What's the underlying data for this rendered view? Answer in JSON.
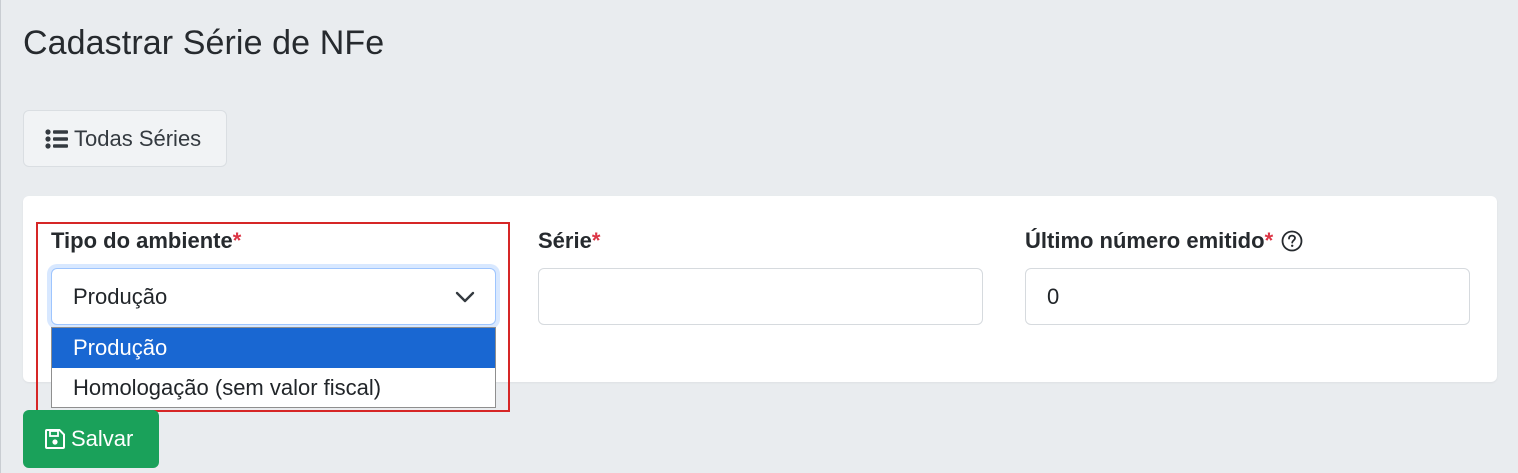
{
  "page": {
    "title": "Cadastrar Série de NFe"
  },
  "toolbar": {
    "all_series_label": "Todas Séries",
    "all_series_icon": "list-icon"
  },
  "form": {
    "environment": {
      "label": "Tipo do ambiente",
      "required_mark": "*",
      "selected": "Produção",
      "options": [
        "Produção",
        "Homologação (sem valor fiscal)"
      ],
      "highlighted_option": "Produção"
    },
    "series": {
      "label": "Série",
      "required_mark": "*",
      "value": ""
    },
    "last_number": {
      "label": "Último número emitido",
      "required_mark": "*",
      "value": "0",
      "help_icon": "question-circle-icon"
    }
  },
  "actions": {
    "save_label": "Salvar",
    "save_icon": "floppy-disk-icon"
  },
  "colors": {
    "background": "#e9ecef",
    "primary_highlight": "#1967d2",
    "success": "#1aa15a",
    "required": "#dc3545",
    "annotation_box": "#d62626"
  }
}
